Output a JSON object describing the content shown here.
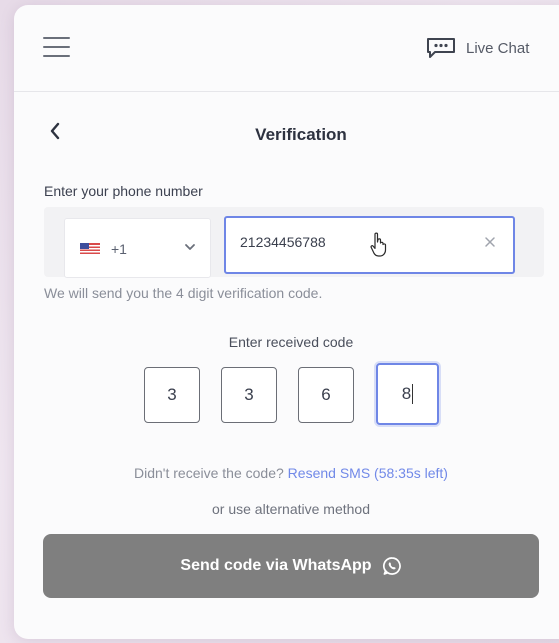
{
  "header": {
    "live_chat_label": "Live Chat"
  },
  "page": {
    "title": "Verification"
  },
  "phone": {
    "label": "Enter your phone number",
    "country_code": "+1",
    "number_value": "21234456788",
    "note": "We will send you the 4 digit verification code."
  },
  "code": {
    "label": "Enter received code",
    "digits": [
      "3",
      "3",
      "6",
      "8"
    ]
  },
  "resend": {
    "prefix": "Didn't receive the code?",
    "link": "Resend SMS (58:35s left)",
    "alternative": "or use alternative method"
  },
  "whatsapp_button": {
    "label": "Send code via WhatsApp"
  },
  "colors": {
    "accent": "#6f86e6",
    "link": "#7189e8",
    "button_bg": "#7f7f7f"
  },
  "icons": {
    "menu": "hamburger-icon",
    "chat": "chat-bubble-icon",
    "back": "chevron-left-icon",
    "country_flag": "us-flag-icon",
    "dropdown": "chevron-down-icon",
    "clear": "close-icon",
    "pointer": "hand-cursor-icon",
    "whatsapp": "whatsapp-icon"
  }
}
